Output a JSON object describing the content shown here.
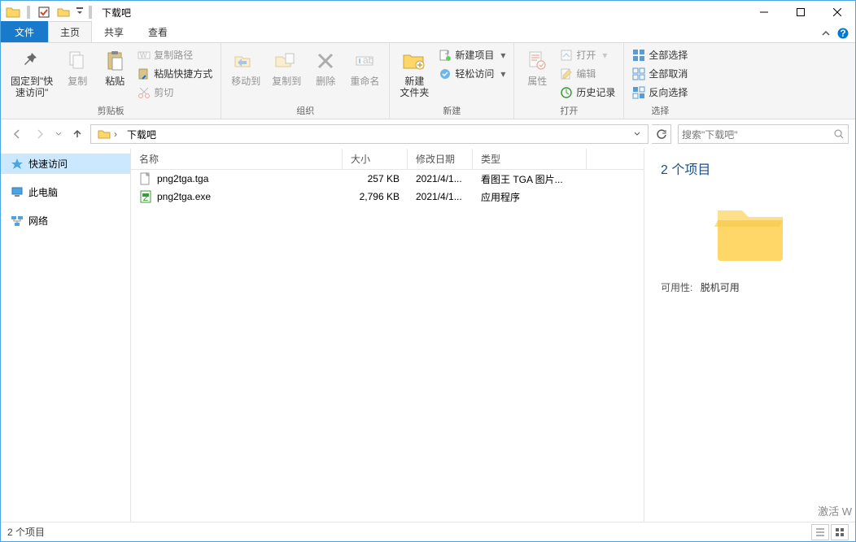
{
  "window": {
    "title": "下载吧"
  },
  "tabs": {
    "file": "文件",
    "home": "主页",
    "share": "共享",
    "view": "查看"
  },
  "ribbon": {
    "clipboard": {
      "label": "剪贴板",
      "pin": "固定到\"快\n速访问\"",
      "copy": "复制",
      "paste": "粘贴",
      "copy_path": "复制路径",
      "paste_shortcut": "粘贴快捷方式",
      "cut": "剪切"
    },
    "organize": {
      "label": "组织",
      "move_to": "移动到",
      "copy_to": "复制到",
      "delete": "删除",
      "rename": "重命名"
    },
    "new": {
      "label": "新建",
      "new_folder": "新建\n文件夹",
      "new_item": "新建项目",
      "easy_access": "轻松访问"
    },
    "open": {
      "label": "打开",
      "properties": "属性",
      "open": "打开",
      "edit": "编辑",
      "history": "历史记录"
    },
    "select": {
      "label": "选择",
      "select_all": "全部选择",
      "select_none": "全部取消",
      "invert": "反向选择"
    }
  },
  "nav": {
    "path_root_icon": "folder",
    "path_segment": "下载吧",
    "search_placeholder": "搜索\"下载吧\""
  },
  "sidebar": {
    "items": [
      {
        "icon": "star",
        "label": "快速访问",
        "active": true
      },
      {
        "icon": "pc",
        "label": "此电脑",
        "active": false
      },
      {
        "icon": "network",
        "label": "网络",
        "active": false
      }
    ]
  },
  "columns": {
    "name": "名称",
    "size": "大小",
    "date": "修改日期",
    "type": "类型"
  },
  "files": [
    {
      "icon": "doc",
      "name": "png2tga.tga",
      "size": "257 KB",
      "date": "2021/4/1...",
      "type": "看图王 TGA 图片..."
    },
    {
      "icon": "exe",
      "name": "png2tga.exe",
      "size": "2,796 KB",
      "date": "2021/4/1...",
      "type": "应用程序"
    }
  ],
  "preview": {
    "count": "2 个项目",
    "availability_label": "可用性:",
    "availability_value": "脱机可用"
  },
  "status": {
    "items": "2 个项目"
  },
  "watermark": "激活 W"
}
